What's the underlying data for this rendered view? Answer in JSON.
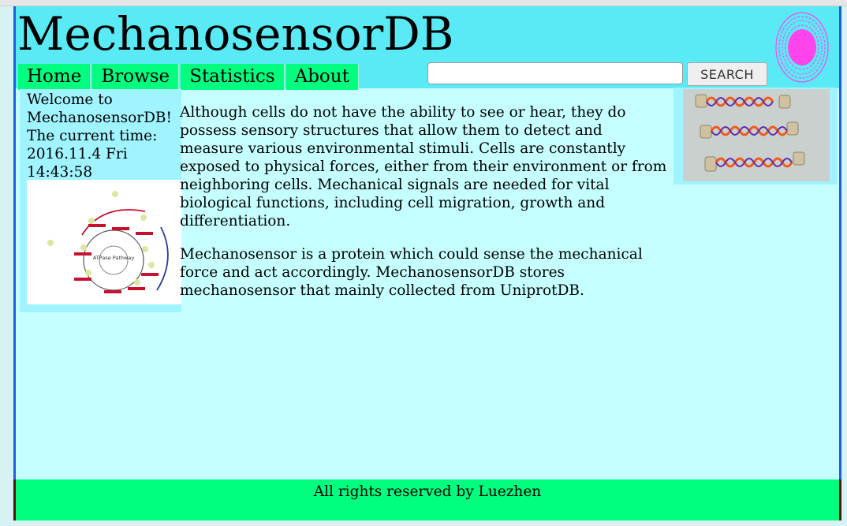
{
  "header": {
    "title": "MechanosensorDB",
    "logo_icon": "flower-logo-icon"
  },
  "nav": {
    "items": [
      {
        "label": "Home"
      },
      {
        "label": "Browse"
      },
      {
        "label": "Statistics"
      },
      {
        "label": "About"
      }
    ]
  },
  "search": {
    "value": "",
    "button_label": "SEARCH"
  },
  "sidebar": {
    "welcome_line1": "Welcome to",
    "welcome_line2": "MechanosensorDB!",
    "time_label": "The current time:",
    "date": "2016.11.4 Fri",
    "time": "14:43:58",
    "figure_center_label": "ATPase Pathway"
  },
  "main": {
    "paragraph1": "Although cells do not have the ability to see or hear, they do possess sensory structures that allow them to detect and measure various environmental stimuli. Cells are constantly exposed to physical forces, either from their environment or from neighboring cells. Mechanical signals are needed for vital biological functions, including cell migration, growth and differentiation.",
    "paragraph2": "Mechanosensor is a protein which could sense the mechanical force and act accordingly. MechanosensorDB stores mechanosensor that mainly collected from UniprotDB."
  },
  "footer": {
    "text": "All rights reserved by Luezhen"
  },
  "colors": {
    "header_bg": "#5aeaf5",
    "nav_bg": "#00ff7f",
    "content_bg": "#c6ffff",
    "sidebar_bg": "#9ff4ff",
    "footer_bg": "#00ff7f",
    "logo": "#ff44ee"
  }
}
